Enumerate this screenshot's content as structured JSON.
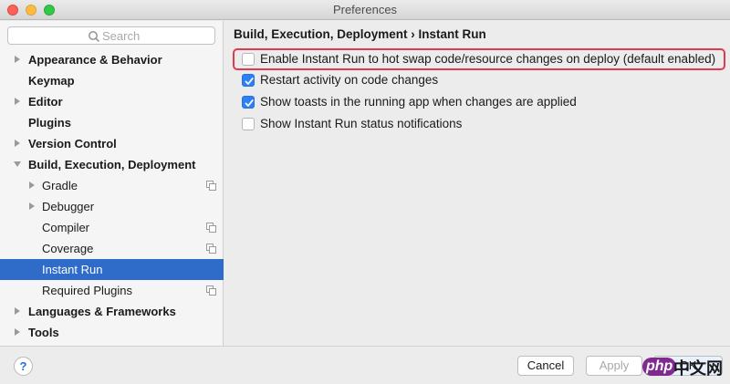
{
  "window": {
    "title": "Preferences"
  },
  "sidebar": {
    "search_placeholder": "Search",
    "items": [
      {
        "label": "Appearance & Behavior"
      },
      {
        "label": "Keymap"
      },
      {
        "label": "Editor"
      },
      {
        "label": "Plugins"
      },
      {
        "label": "Version Control"
      },
      {
        "label": "Build, Execution, Deployment"
      },
      {
        "label": "Gradle"
      },
      {
        "label": "Debugger"
      },
      {
        "label": "Compiler"
      },
      {
        "label": "Coverage"
      },
      {
        "label": "Instant Run"
      },
      {
        "label": "Required Plugins"
      },
      {
        "label": "Languages & Frameworks"
      },
      {
        "label": "Tools"
      }
    ],
    "selected": "Instant Run"
  },
  "content": {
    "breadcrumb": "Build, Execution, Deployment › Instant Run",
    "options": [
      {
        "label": "Enable Instant Run to hot swap code/resource changes on deploy (default enabled)",
        "checked": false
      },
      {
        "label": "Restart activity on code changes",
        "checked": true
      },
      {
        "label": "Show toasts in the running app when changes are applied",
        "checked": true
      },
      {
        "label": "Show Instant Run status notifications",
        "checked": false
      }
    ]
  },
  "footer": {
    "help_label": "?",
    "cancel_label": "Cancel",
    "apply_label": "Apply",
    "ok_label": "OK"
  },
  "watermark": {
    "brand": "php",
    "site": "中文网"
  },
  "colors": {
    "selection": "#2f6bc9",
    "checkbox_checked": "#2d7ff9",
    "highlight_border": "#e03a4f"
  }
}
